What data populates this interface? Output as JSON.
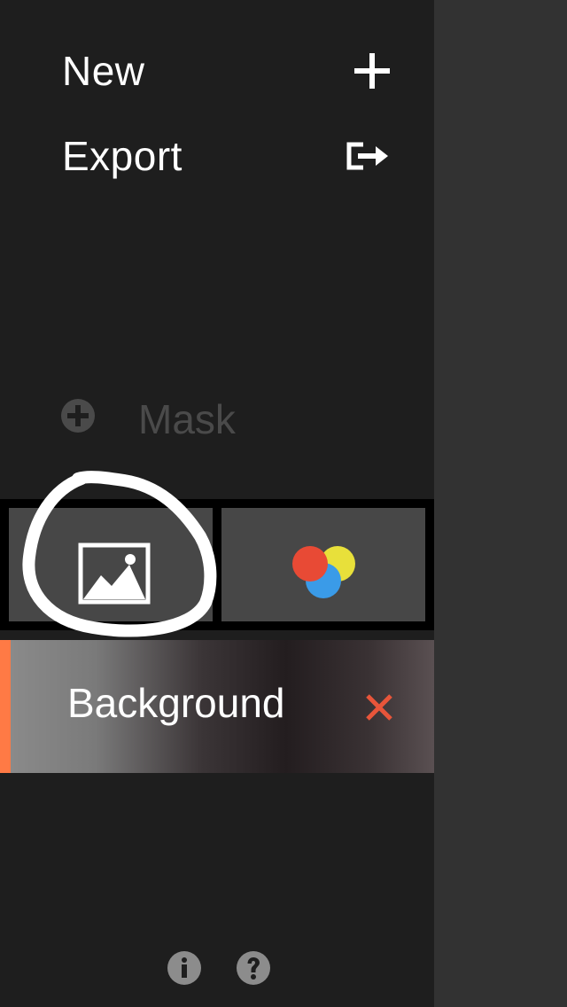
{
  "menu": {
    "new_label": "New",
    "new_icon": "plus-icon",
    "export_label": "Export",
    "export_icon": "export-icon"
  },
  "mask": {
    "label": "Mask",
    "icon": "add-circle-icon"
  },
  "tools": {
    "image_icon": "image-icon",
    "color_icon": "color-circles-icon"
  },
  "layers": [
    {
      "name": "Background",
      "delete_icon": "close-icon"
    }
  ],
  "footer": {
    "info_icon": "info-icon",
    "help_icon": "help-icon"
  },
  "colors": {
    "sidebar_bg": "#1e1e1e",
    "right_pane_bg": "#323232",
    "tool_bg": "#474747",
    "accent_orange": "#ff7a45",
    "delete_red": "#e8553a",
    "circle_red": "#e84a35",
    "circle_yellow": "#e8e03a",
    "circle_blue": "#3a9be8"
  }
}
